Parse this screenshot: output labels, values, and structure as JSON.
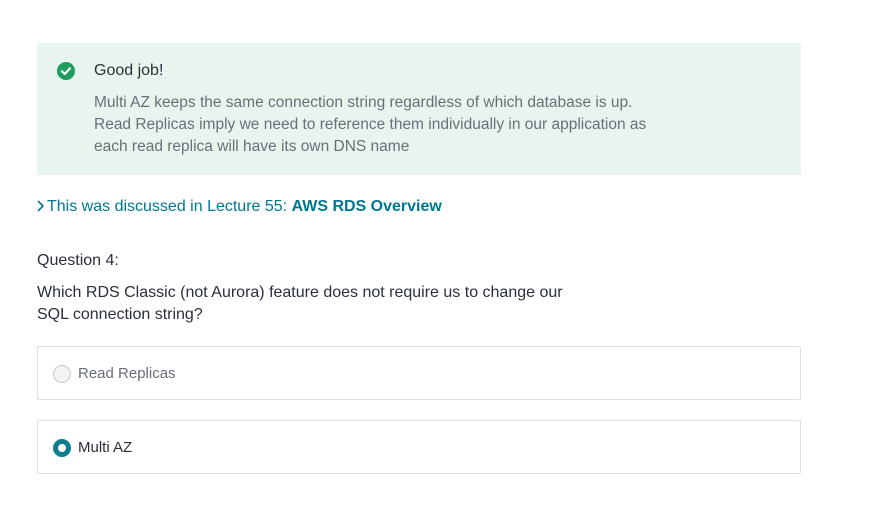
{
  "feedback": {
    "icon": "check-circle-icon",
    "status_color": "#1e9d5e",
    "background_color": "#e8f5ee",
    "title": "Good job!",
    "explanation_lines": [
      "Multi AZ keeps the same connection string regardless of which database is up.",
      "Read Replicas imply we need to reference them individually in our application as",
      "each read replica will have its own DNS name"
    ]
  },
  "lecture_link": {
    "icon": "chevron-right-icon",
    "prefix": "This was discussed in Lecture 55: ",
    "title": "AWS RDS Overview",
    "color": "#007791"
  },
  "question": {
    "number_label": "Question 4:",
    "text_lines": [
      "Which RDS Classic (not Aurora) feature does not require us to change our",
      "SQL connection string?"
    ],
    "options": [
      {
        "label": "Read Replicas",
        "selected": false
      },
      {
        "label": "Multi AZ",
        "selected": true
      }
    ],
    "selected_color": "#0f7c90"
  }
}
